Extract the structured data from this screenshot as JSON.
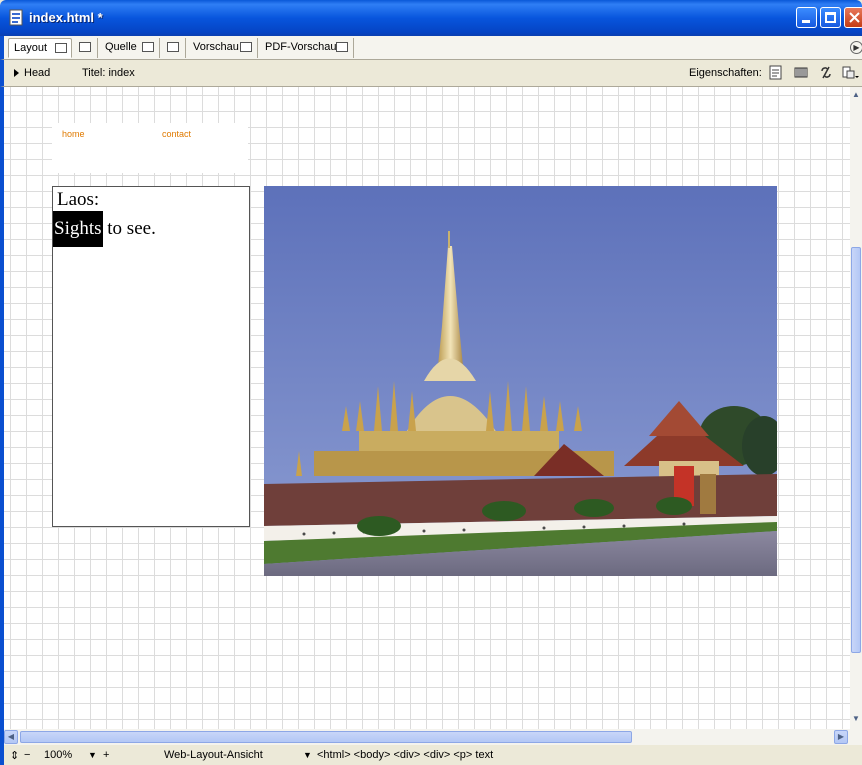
{
  "window": {
    "title": "index.html *"
  },
  "tabs": [
    {
      "label": "Layout",
      "icon": "layout-view-icon"
    },
    {
      "label": "",
      "icon": "split-view-icon"
    },
    {
      "label": "Quelle",
      "icon": "source-view-icon"
    },
    {
      "label": "",
      "icon": "script-view-icon"
    },
    {
      "label": "Vorschau",
      "icon": "preview-icon"
    },
    {
      "label": "PDF-Vorschau",
      "icon": "pdf-preview-icon"
    }
  ],
  "headbar": {
    "head_label": "Head",
    "title_label": "Titel: index",
    "properties_label": "Eigenschaften:"
  },
  "page": {
    "nav": {
      "home": "home",
      "contact": "contact"
    },
    "side_title": "Laos:",
    "side_selected": "Sights",
    "side_rest": " to see.",
    "photo_alt": "Pha That Luang stupa"
  },
  "statusbar": {
    "zoom": "100%",
    "view_mode": "Web-Layout-Ansicht",
    "breadcrumb": "<html> <body> <div> <div> <p> text"
  },
  "colors": {
    "link": "#e07a00",
    "titlebar": "#0855dd",
    "selection": "#000000"
  }
}
